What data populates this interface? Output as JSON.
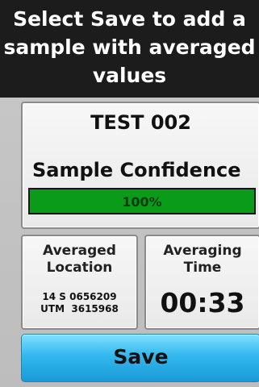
{
  "header": {
    "line1": "Select Save to add a",
    "line2": "sample with averaged",
    "line3": "values"
  },
  "sample": {
    "name": "TEST  002",
    "confidence_label": "Sample Confidence",
    "confidence_text": "100%",
    "confidence_fraction": 1.0
  },
  "averaged_location": {
    "title_line1": "Averaged",
    "title_line2": "Location",
    "coord_line1": "14 S 0656209",
    "coord_line2": "UTM  3615968"
  },
  "averaging_time": {
    "title_line1": "Averaging",
    "title_line2": "Time",
    "value": "00:33"
  },
  "save_button": {
    "label": "Save"
  },
  "colors": {
    "header_bg": "#1c1c1c",
    "progress_fill": "#0a9b18",
    "save_button": "#32b7ee"
  }
}
